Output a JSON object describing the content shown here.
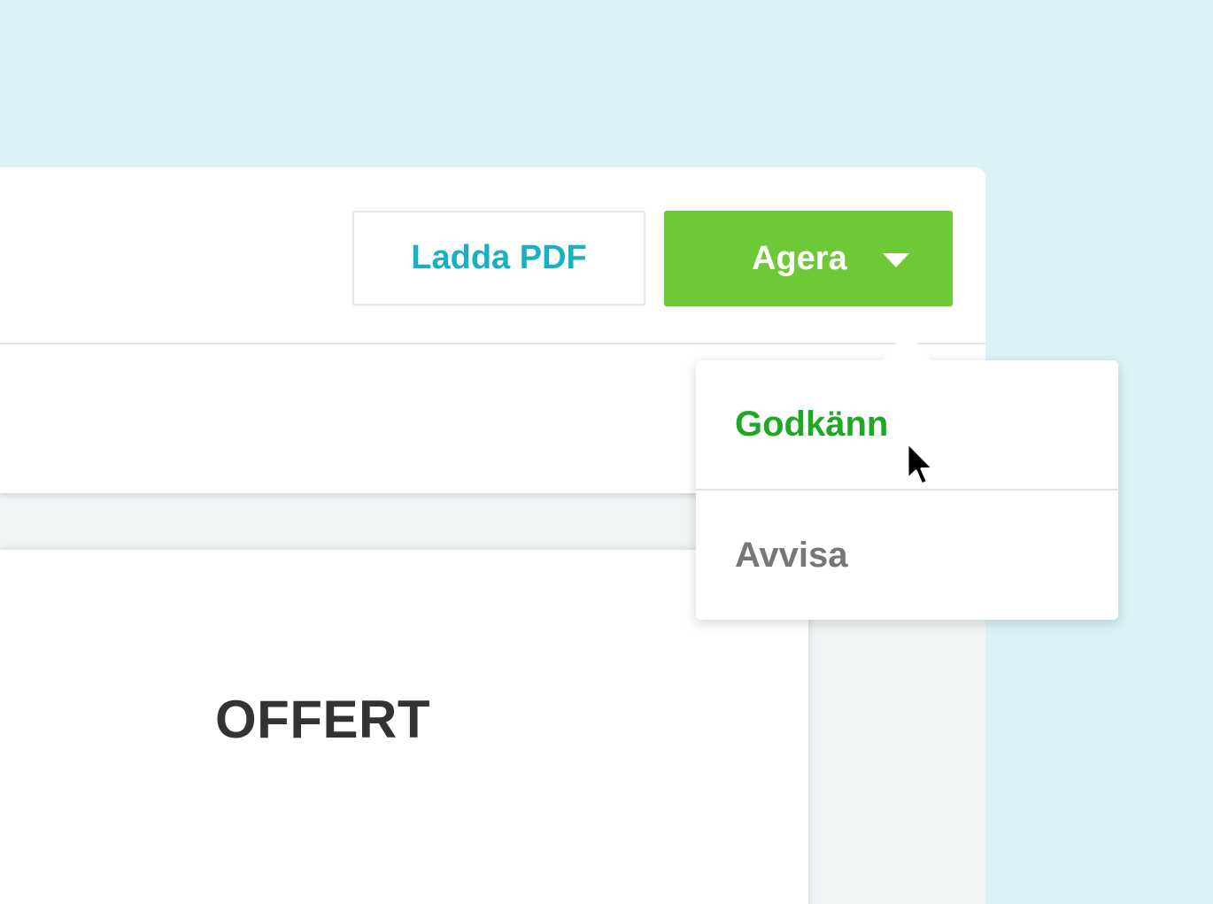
{
  "toolbar": {
    "download_pdf_label": "Ladda PDF",
    "action_label": "Agera"
  },
  "dropdown": {
    "items": [
      {
        "label": "Godkänn",
        "color": "#1fa824"
      },
      {
        "label": "Avvisa",
        "color": "#777777"
      }
    ]
  },
  "document": {
    "title": "OFFERT"
  },
  "colors": {
    "background": "#dbf2f6",
    "primary_button": "#6dc935",
    "link_text": "#1bafc4"
  },
  "icons": {
    "caret": "caret-down-icon",
    "cursor": "mouse-pointer-icon"
  }
}
